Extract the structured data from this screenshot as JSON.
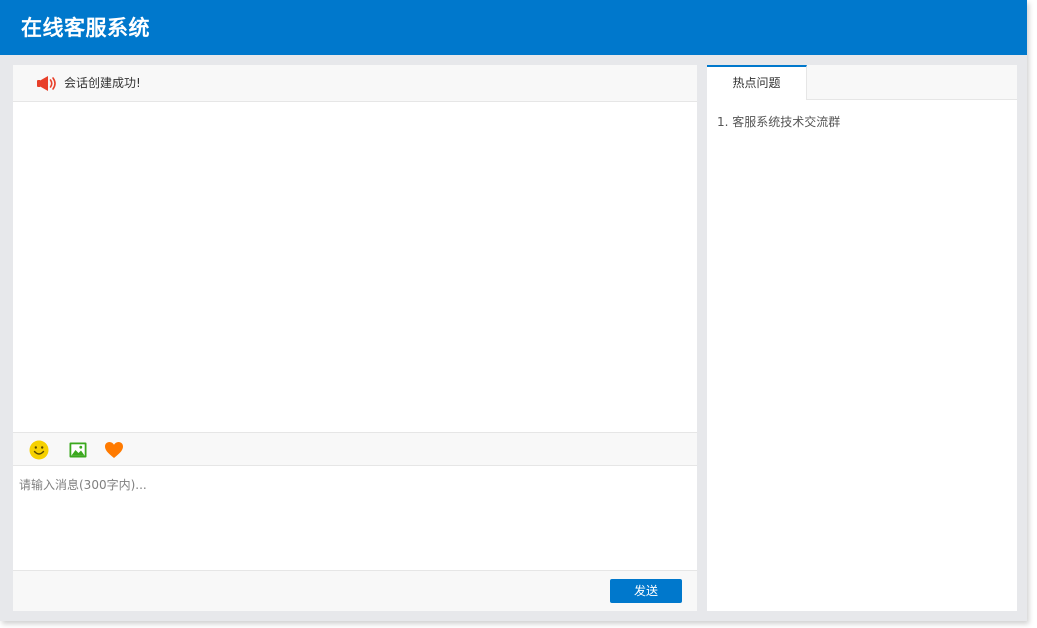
{
  "header": {
    "title": "在线客服系统"
  },
  "chat": {
    "notice": {
      "icon": "megaphone-icon",
      "text": "会话创建成功!"
    },
    "toolbar": {
      "tools": [
        {
          "icon": "smiley-icon",
          "color": "#f6d100"
        },
        {
          "icon": "image-icon",
          "color": "#3aa81e"
        },
        {
          "icon": "heart-icon",
          "color": "#ff7a00"
        }
      ]
    },
    "input": {
      "placeholder": "请输入消息(300字内)...",
      "value": ""
    },
    "send_label": "发送"
  },
  "side": {
    "tabs": [
      {
        "label": "热点问题",
        "active": true
      }
    ],
    "faq": [
      {
        "label": "1. 客服系统技术交流群"
      }
    ]
  },
  "colors": {
    "primary": "#0078cc",
    "background": "#e7e8eb",
    "bar": "#f8f8f8",
    "notice_icon": "#e8402a"
  }
}
